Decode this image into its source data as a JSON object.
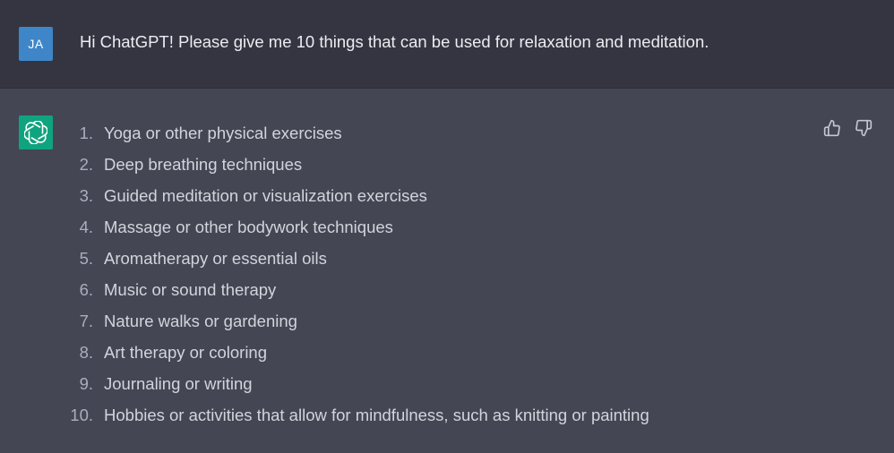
{
  "user": {
    "avatar_initials": "JA",
    "message": "Hi ChatGPT! Please give me 10 things that can be used for relaxation and meditation."
  },
  "assistant": {
    "avatar_icon": "openai-logo-icon",
    "items": [
      {
        "num": "1.",
        "text": "Yoga or other physical exercises"
      },
      {
        "num": "2.",
        "text": "Deep breathing techniques"
      },
      {
        "num": "3.",
        "text": "Guided meditation or visualization exercises"
      },
      {
        "num": "4.",
        "text": "Massage or other bodywork techniques"
      },
      {
        "num": "5.",
        "text": "Aromatherapy or essential oils"
      },
      {
        "num": "6.",
        "text": "Music or sound therapy"
      },
      {
        "num": "7.",
        "text": "Nature walks or gardening"
      },
      {
        "num": "8.",
        "text": "Art therapy or coloring"
      },
      {
        "num": "9.",
        "text": "Journaling or writing"
      },
      {
        "num": "10.",
        "text": "Hobbies or activities that allow for mindfulness, such as knitting or painting"
      }
    ],
    "feedback_icons": [
      "thumbs-up-icon",
      "thumbs-down-icon"
    ]
  },
  "colors": {
    "user_row_bg": "#343541",
    "assistant_row_bg": "#444654",
    "user_avatar": "#3f86c9",
    "assistant_avatar": "#10a37f"
  }
}
